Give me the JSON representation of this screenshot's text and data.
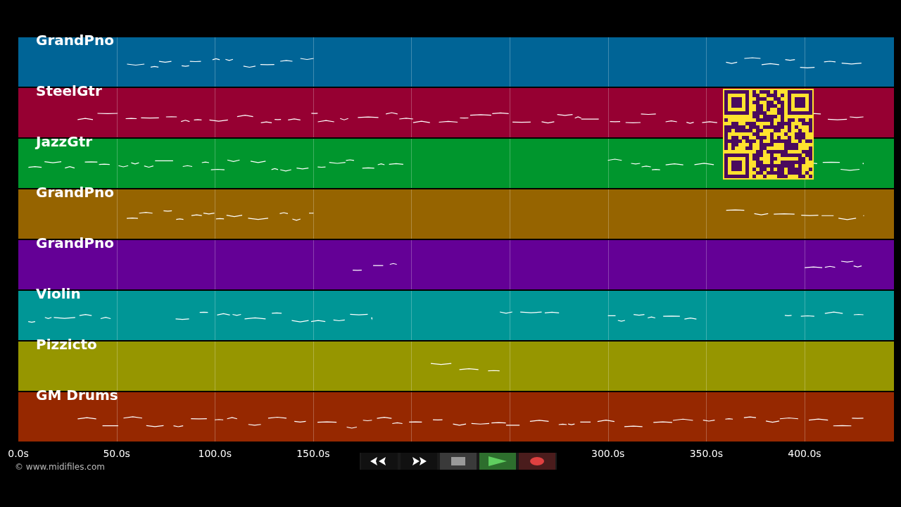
{
  "tracks": [
    {
      "name": "GrandPno",
      "color": "#006496"
    },
    {
      "name": "SteelGtr",
      "color": "#960032"
    },
    {
      "name": "JazzGtr",
      "color": "#00962d"
    },
    {
      "name": "GrandPno",
      "color": "#966400"
    },
    {
      "name": "GrandPno",
      "color": "#640096"
    },
    {
      "name": "Violin",
      "color": "#009696"
    },
    {
      "name": "Pizzicto",
      "color": "#969600"
    },
    {
      "name": "GM Drums",
      "color": "#962800"
    }
  ],
  "axis": {
    "ticks": [
      {
        "label": "0.0s"
      },
      {
        "label": "50.0s"
      },
      {
        "label": "100.0s"
      },
      {
        "label": "150.0s"
      },
      {
        "label": "300.0s"
      },
      {
        "label": "350.0s"
      },
      {
        "label": "400.0s"
      }
    ]
  },
  "copyright": "© www.midifiles.com",
  "transport": [
    {
      "kind": "rewind"
    },
    {
      "kind": "forward"
    },
    {
      "kind": "stop"
    },
    {
      "kind": "play"
    },
    {
      "kind": "record"
    }
  ]
}
